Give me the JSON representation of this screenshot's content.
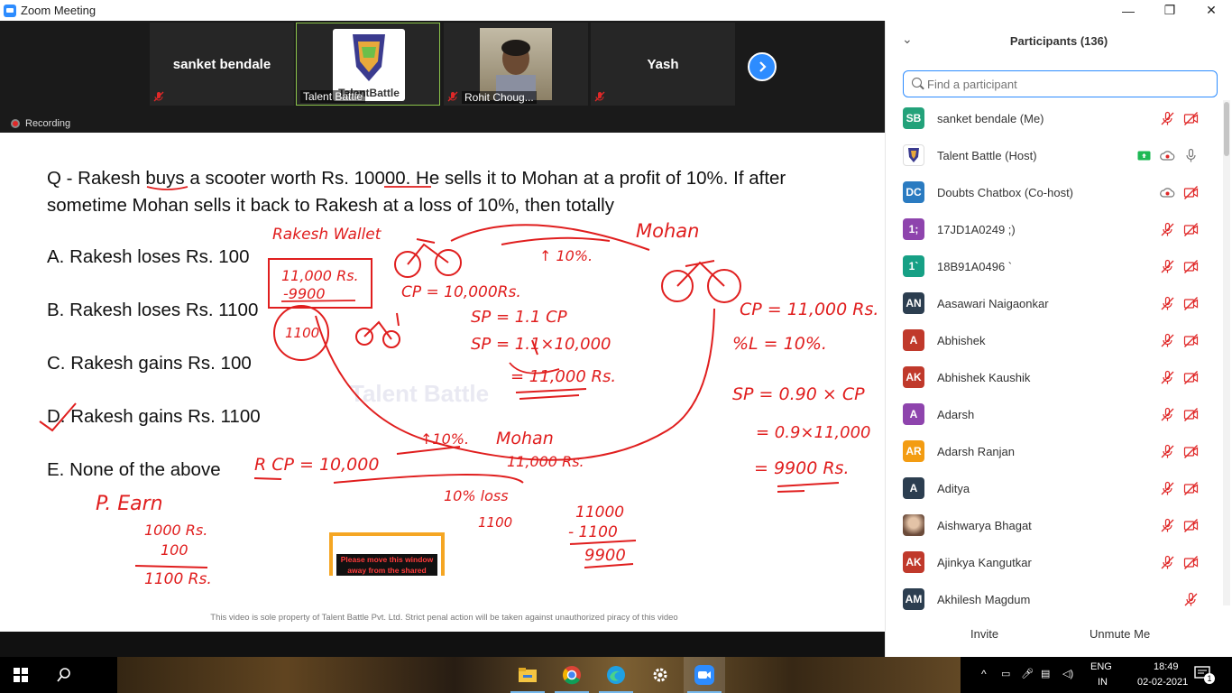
{
  "window": {
    "title": "Zoom Meeting",
    "controls": {
      "minimize": "—",
      "restore": "❐",
      "close": "✕"
    }
  },
  "video_strip": {
    "tiles": [
      {
        "name": "sanket bendale",
        "muted": true
      },
      {
        "name": "Talent Battle",
        "logo_text": "TalentBattle",
        "active": true
      },
      {
        "name": "Rohit Choug...",
        "muted": true
      },
      {
        "name": "Yash",
        "muted": true
      }
    ],
    "next_icon": "chevron-right-icon",
    "recording_label": "Recording"
  },
  "slide": {
    "question": "Q - Rakesh buys a scooter worth Rs. 10000. He sells it to Mohan at a profit of 10%. If after sometime Mohan sells it back to Rakesh at a loss of 10%, then totally",
    "options": [
      "A. Rakesh loses Rs. 100",
      "B. Rakesh loses Rs. 1100",
      "C. Rakesh gains Rs. 100",
      "D. Rakesh gains Rs. 1100",
      "E. None of the above"
    ],
    "watermark": "Talent Battle",
    "footer_note": "This video is sole property of Talent Battle Pvt. Ltd. Strict penal action will be taken against unauthorized piracy of this video",
    "popup_text": "Please move this window away from the shared",
    "annotations": {
      "rakesh_wallet": "Rakesh Wallet",
      "wallet_1": "11,000 Rs.",
      "wallet_2": "-9900",
      "circle_1100": "1100",
      "cp": "CP = 10,000Rs.",
      "up10": "↑ 10%.",
      "mohan_top": "Mohan",
      "sp1": "SP = 1.1 CP",
      "sp2": "SP = 1.1×10,000",
      "sp3": "= 11,000 Rs.",
      "cp2": "CP = 11,000 Rs.",
      "loss": "%L = 10%.",
      "sp4": "SP = 0.90 × CP",
      "sp5": "= 0.9×11,000",
      "sp6": "= 9900 Rs.",
      "rcp": "R CP = 10,000",
      "up10b": "↑10%.",
      "mohan2": "Mohan",
      "mohan2_amt": "11,000 Rs.",
      "loss10": "10% loss",
      "l1100": "1100",
      "sub1": "11000",
      "sub2": "- 1100",
      "sub3": "9900",
      "p_earn": "P. Earn",
      "earn1": "1000 Rs.",
      "earn2": "100",
      "earn3": "1100 Rs."
    }
  },
  "participants": {
    "title": "Participants (136)",
    "search_placeholder": "Find a participant",
    "list": [
      {
        "initials": "SB",
        "name": "sanket bendale (Me)",
        "color": "#23a27a",
        "icons": [
          "mic-muted-icon",
          "video-off-icon"
        ]
      },
      {
        "initials": "",
        "name": "Talent Battle (Host)",
        "color": "#ffffff",
        "avatar": "logo",
        "icons": [
          "share-screen-icon",
          "recording-cloud-icon",
          "mic-on-icon"
        ]
      },
      {
        "initials": "DC",
        "name": "Doubts Chatbox (Co-host)",
        "color": "#2a7bc1",
        "icons": [
          "recording-cloud-icon",
          "video-off-icon"
        ]
      },
      {
        "initials": "1;",
        "name": "17JD1A0249 ;)",
        "color": "#8e44ad",
        "icons": [
          "mic-muted-icon",
          "video-off-icon"
        ]
      },
      {
        "initials": "1`",
        "name": "18B91A0496 `",
        "color": "#16a085",
        "icons": [
          "mic-muted-icon",
          "video-off-icon"
        ]
      },
      {
        "initials": "AN",
        "name": "Aasawari Naigaonkar",
        "color": "#2c3e50",
        "icons": [
          "mic-muted-icon",
          "video-off-icon"
        ]
      },
      {
        "initials": "A",
        "name": "Abhishek",
        "color": "#c0392b",
        "icons": [
          "mic-muted-icon",
          "video-off-icon"
        ]
      },
      {
        "initials": "AK",
        "name": "Abhishek Kaushik",
        "color": "#c0392b",
        "icons": [
          "mic-muted-icon",
          "video-off-icon"
        ]
      },
      {
        "initials": "A",
        "name": "Adarsh",
        "color": "#8e44ad",
        "icons": [
          "mic-muted-icon",
          "video-off-icon"
        ]
      },
      {
        "initials": "AR",
        "name": "Adarsh Ranjan",
        "color": "#f39c12",
        "icons": [
          "mic-muted-icon",
          "video-off-icon"
        ]
      },
      {
        "initials": "A",
        "name": "Aditya",
        "color": "#2c3e50",
        "icons": [
          "mic-muted-icon",
          "video-off-icon"
        ]
      },
      {
        "initials": "",
        "name": "Aishwarya Bhagat",
        "color": "#ffffff",
        "avatar": "photo",
        "icons": [
          "mic-muted-icon",
          "video-off-icon"
        ]
      },
      {
        "initials": "AK",
        "name": "Ajinkya Kangutkar",
        "color": "#c0392b",
        "icons": [
          "mic-muted-icon",
          "video-off-icon"
        ]
      },
      {
        "initials": "AM",
        "name": "Akhilesh Magdum",
        "color": "#2c3e50",
        "icons": [
          "mic-muted-icon"
        ]
      }
    ],
    "invite_label": "Invite",
    "unmute_label": "Unmute Me"
  },
  "taskbar": {
    "apps": [
      "start-icon",
      "search-icon",
      "file-explorer-icon",
      "chrome-icon",
      "edge-icon",
      "settings-icon",
      "zoom-icon"
    ],
    "lang_top": "ENG",
    "lang_bottom": "IN",
    "time": "18:49",
    "date": "02-02-2021",
    "notifications": "1"
  },
  "colors": {
    "zoom_blue": "#2d8cff",
    "ink_red": "#e01e1e",
    "mute_red": "#e02828"
  }
}
